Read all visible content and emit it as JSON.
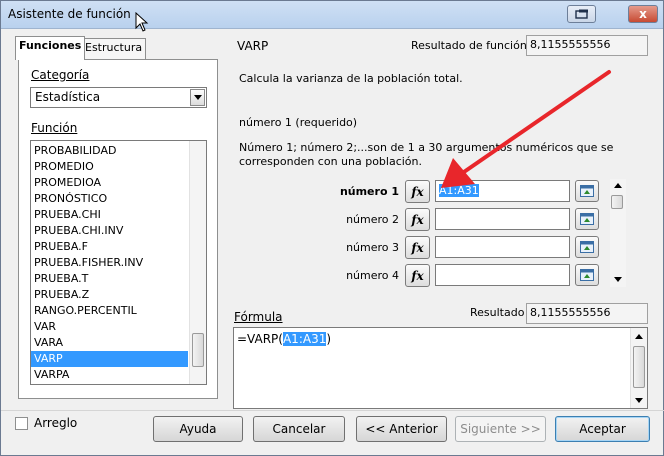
{
  "window": {
    "title": "Asistente de función",
    "buttons": {
      "restore_icon": "restore-icon",
      "close_glyph": "x"
    }
  },
  "tabs": [
    {
      "label": "Funciones",
      "active": true
    },
    {
      "label": "Estructura",
      "active": false
    }
  ],
  "left_panel": {
    "category_label": "Categoría",
    "category_value": "Estadística",
    "function_label": "Función",
    "functions": [
      "PROBABILIDAD",
      "PROMEDIO",
      "PROMEDIOA",
      "PRONÓSTICO",
      "PRUEBA.CHI",
      "PRUEBA.CHI.INV",
      "PRUEBA.F",
      "PRUEBA.FISHER.INV",
      "PRUEBA.T",
      "PRUEBA.Z",
      "RANGO.PERCENTIL",
      "VAR",
      "VARA",
      "VARP",
      "VARPA"
    ],
    "selected_function": "VARP"
  },
  "right_panel": {
    "function_name": "VARP",
    "function_result_label": "Resultado de función",
    "function_result_value": "8,1155555556",
    "description": "Calcula la varianza de la población total.",
    "argument_title": "número 1 (requerido)",
    "argument_desc_line1": "Número 1; número 2;...son de 1 a 30 argumentos numéricos que se",
    "argument_desc_line2": "corresponden con una población.",
    "arguments": [
      {
        "label": "número 1",
        "value": "A1:A31",
        "bold": true
      },
      {
        "label": "número 2",
        "value": ""
      },
      {
        "label": "número 3",
        "value": ""
      },
      {
        "label": "número 4",
        "value": ""
      }
    ],
    "fx_label": "fx",
    "formula_label": "Fórmula",
    "result_label": "Resultado",
    "result_value": "8,1155555556",
    "formula_prefix": "=VARP(",
    "formula_selected": "A1:A31",
    "formula_suffix": ")"
  },
  "footer": {
    "array_label": "Arreglo",
    "array_checked": false,
    "help_label": "Ayuda",
    "cancel_label": "Cancelar",
    "previous_label": "<< Anterior",
    "next_label": "Siguiente >>",
    "next_disabled": true,
    "accept_label": "Aceptar"
  },
  "colors": {
    "selection": "#3399ff",
    "annotation_arrow": "#e8262b",
    "titlebar": "#c3d8f1"
  }
}
